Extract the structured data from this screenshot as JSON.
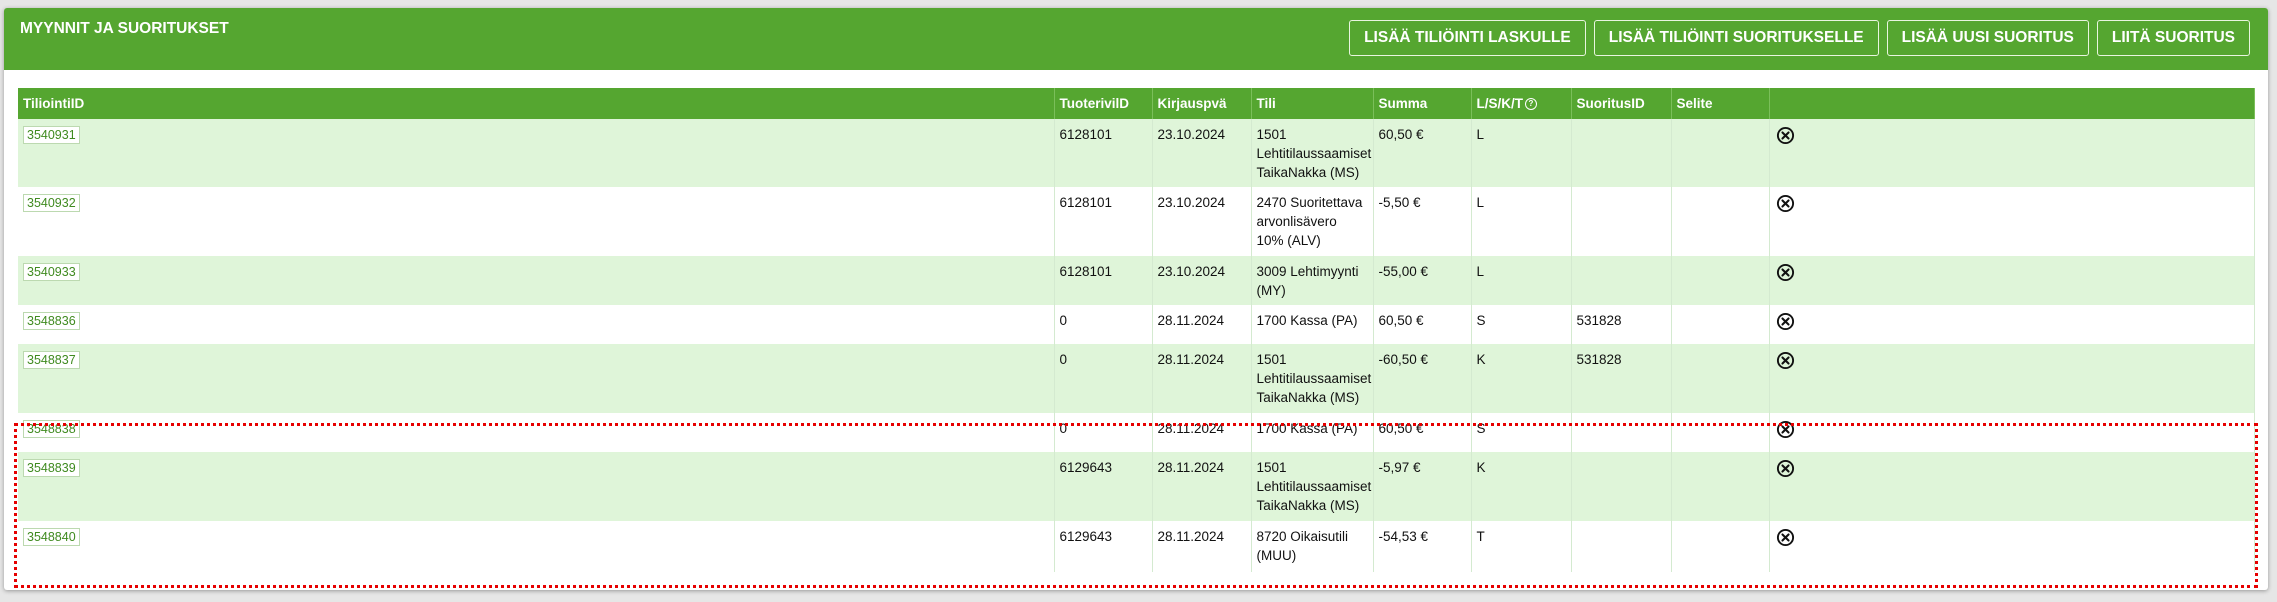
{
  "header": {
    "title": "MYYNNIT JA SUORITUKSET",
    "buttons": [
      "LISÄÄ TILIÖINTI LASKULLE",
      "LISÄÄ TILIÖINTI SUORITUKSELLE",
      "LISÄÄ UUSI SUORITUS",
      "LIITÄ SUORITUS"
    ]
  },
  "table": {
    "columns": [
      "TiliointiID",
      "TuoterivilD",
      "Kirjauspvä",
      "Tili",
      "Summa",
      "L/S/K/T",
      "SuoritusID",
      "Selite",
      ""
    ],
    "rows": [
      {
        "id": "3540931",
        "tuoterivi": "6128101",
        "pvm": "23.10.2024",
        "tili": "1501 Lehtitilaussaamiset TaikaNakka (MS)",
        "summa": "60,50 €",
        "lskt": "L",
        "suoritus": "",
        "selite": ""
      },
      {
        "id": "3540932",
        "tuoterivi": "6128101",
        "pvm": "23.10.2024",
        "tili": "2470 Suoritettava arvonlisävero 10% (ALV)",
        "summa": "-5,50 €",
        "lskt": "L",
        "suoritus": "",
        "selite": ""
      },
      {
        "id": "3540933",
        "tuoterivi": "6128101",
        "pvm": "23.10.2024",
        "tili": "3009 Lehtimyynti (MY)",
        "summa": "-55,00 €",
        "lskt": "L",
        "suoritus": "",
        "selite": ""
      },
      {
        "id": "3548836",
        "tuoterivi": "0",
        "pvm": "28.11.2024",
        "tili": "1700 Kassa (PA)",
        "summa": "60,50 €",
        "lskt": "S",
        "suoritus": "531828",
        "selite": ""
      },
      {
        "id": "3548837",
        "tuoterivi": "0",
        "pvm": "28.11.2024",
        "tili": "1501 Lehtitilaussaamiset TaikaNakka (MS)",
        "summa": "-60,50 €",
        "lskt": "K",
        "suoritus": "531828",
        "selite": ""
      },
      {
        "id": "3548838",
        "tuoterivi": "0",
        "pvm": "28.11.2024",
        "tili": "1700 Kassa (PA)",
        "summa": "60,50 €",
        "lskt": "S",
        "suoritus": "",
        "selite": ""
      },
      {
        "id": "3548839",
        "tuoterivi": "6129643",
        "pvm": "28.11.2024",
        "tili": "1501 Lehtitilaussaamiset TaikaNakka (MS)",
        "summa": "-5,97 €",
        "lskt": "K",
        "suoritus": "",
        "selite": ""
      },
      {
        "id": "3548840",
        "tuoterivi": "6129643",
        "pvm": "28.11.2024",
        "tili": "8720 Oikaisutili (MUU)",
        "summa": "-54,53 €",
        "lskt": "T",
        "suoritus": "",
        "selite": ""
      }
    ]
  },
  "icons": {
    "help": "help-circle-icon",
    "delete": "close-circle-icon"
  },
  "colors": {
    "header": "#55a630",
    "odd_row": "#dff5d9",
    "highlight": "#e60000"
  }
}
